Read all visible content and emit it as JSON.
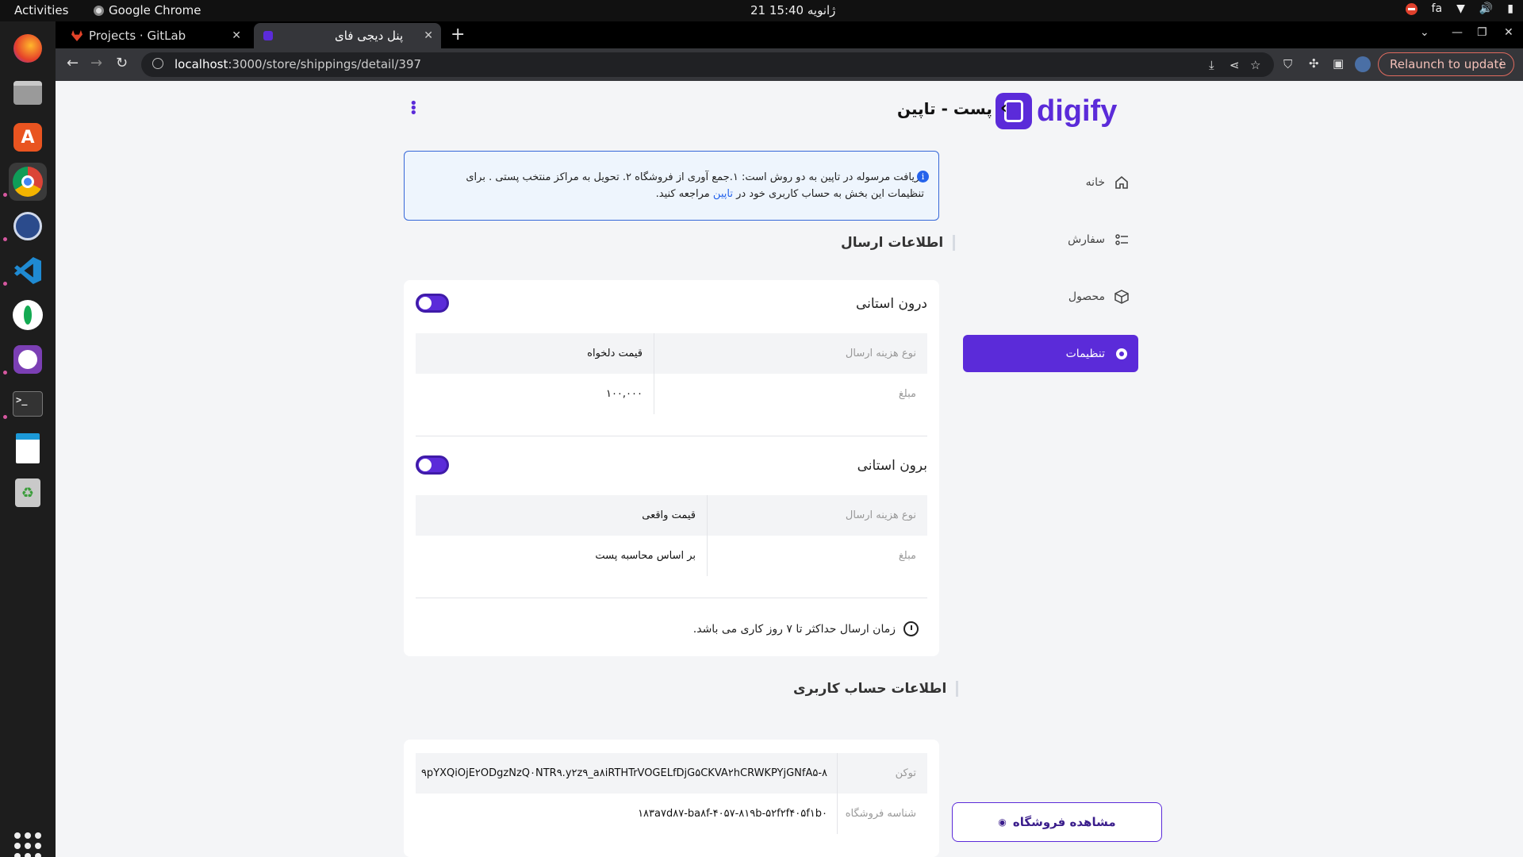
{
  "os": {
    "activities": "Activities",
    "app_name": "Google Chrome",
    "clock": "21 ژانویه  15:40",
    "lang": "fa"
  },
  "browser": {
    "tabs": [
      {
        "label": "Projects · GitLab"
      },
      {
        "label": "پنل دیجی فای"
      }
    ],
    "url_host": "localhost",
    "url_path": ":3000/store/shippings/detail/397",
    "relaunch": "Relaunch to update"
  },
  "sidebar": {
    "logo": "digify",
    "items": [
      {
        "label": "خانه",
        "icon": "home-icon"
      },
      {
        "label": "سفارش",
        "icon": "orders-icon"
      },
      {
        "label": "محصول",
        "icon": "box-icon"
      },
      {
        "label": "تنظیمات",
        "icon": "gear-icon"
      }
    ],
    "view_store": "مشاهده فروشگاه"
  },
  "header": {
    "title": "پست - تاپین"
  },
  "alert": {
    "text": "دریافت مرسوله در تاپین به دو روش است: ۱.جمع آوری از فروشگاه ۲. تحویل به مراکز منتخب پستی . برای تنظیمات این بخش به حساب کاربری خود در",
    "link": "تاپین",
    "suffix": "مراجعه کنید."
  },
  "shipping": {
    "section_title": "اطلاعات ارسال",
    "intra": {
      "title": "درون استانی",
      "enabled": true,
      "type_label": "نوع هزینه ارسال",
      "type_value": "قیمت دلخواه",
      "amount_label": "مبلغ",
      "amount_value": "۱۰۰,۰۰۰"
    },
    "inter": {
      "title": "برون استانی",
      "enabled": true,
      "type_label": "نوع هزینه ارسال",
      "type_value": "قیمت واقعی",
      "amount_label": "مبلغ",
      "amount_value": "بر اساس محاسبه پست"
    },
    "note": "زمان ارسال حداکثر تا ۷ روز کاری می باشد."
  },
  "account": {
    "section_title": "اطلاعات حساب کاربری",
    "token_label": "توکن",
    "token_value": "۹pYXQiOjE۲ODgzNzQ۰NTR۹.y۲z۹_a۸iRTHTrVOGELfDjG۵CKVA۲hCRWKPYjGNfA۵-۸",
    "store_id_label": "شناسه فروشگاه",
    "store_id_value": "۱۸۳a۷d۸۷-ba۸f-۴۰۵۷-۸۱۹b-۵۲f۲f۴۰۵f۱b۰"
  }
}
